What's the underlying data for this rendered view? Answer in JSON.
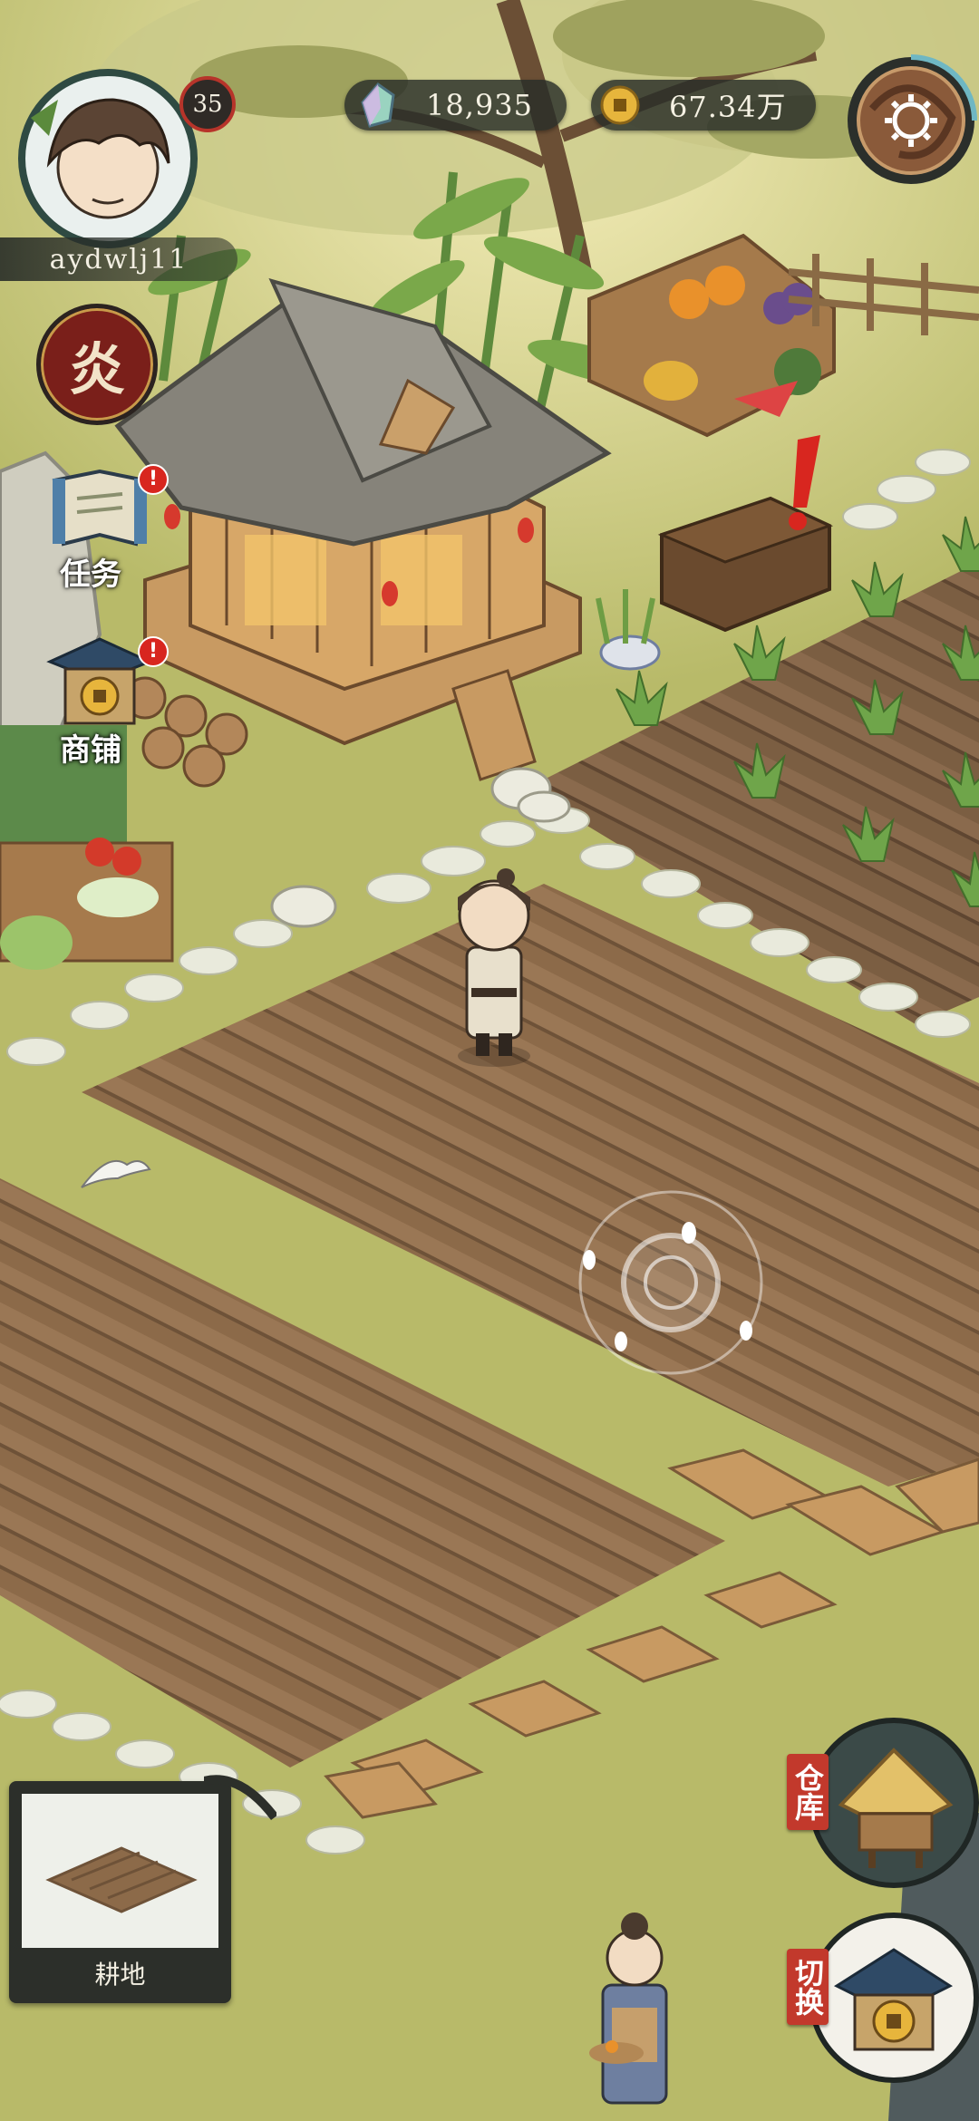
{
  "player": {
    "username": "aydwlj11",
    "level": "35"
  },
  "currency": {
    "gems": "18,935",
    "coins": "67.34万"
  },
  "side_menu": {
    "event_label": "炎",
    "tasks_label": "任务",
    "shop_label": "商铺"
  },
  "build_panel": {
    "item_label": "耕地"
  },
  "bottom_right": {
    "warehouse_label": "仓库",
    "switch_label": "切换"
  },
  "colors": {
    "grass": "#b9bb6a",
    "soil": "#8a6a4a",
    "alert": "#d8261f",
    "hud_dark": "#2b2f2b"
  }
}
